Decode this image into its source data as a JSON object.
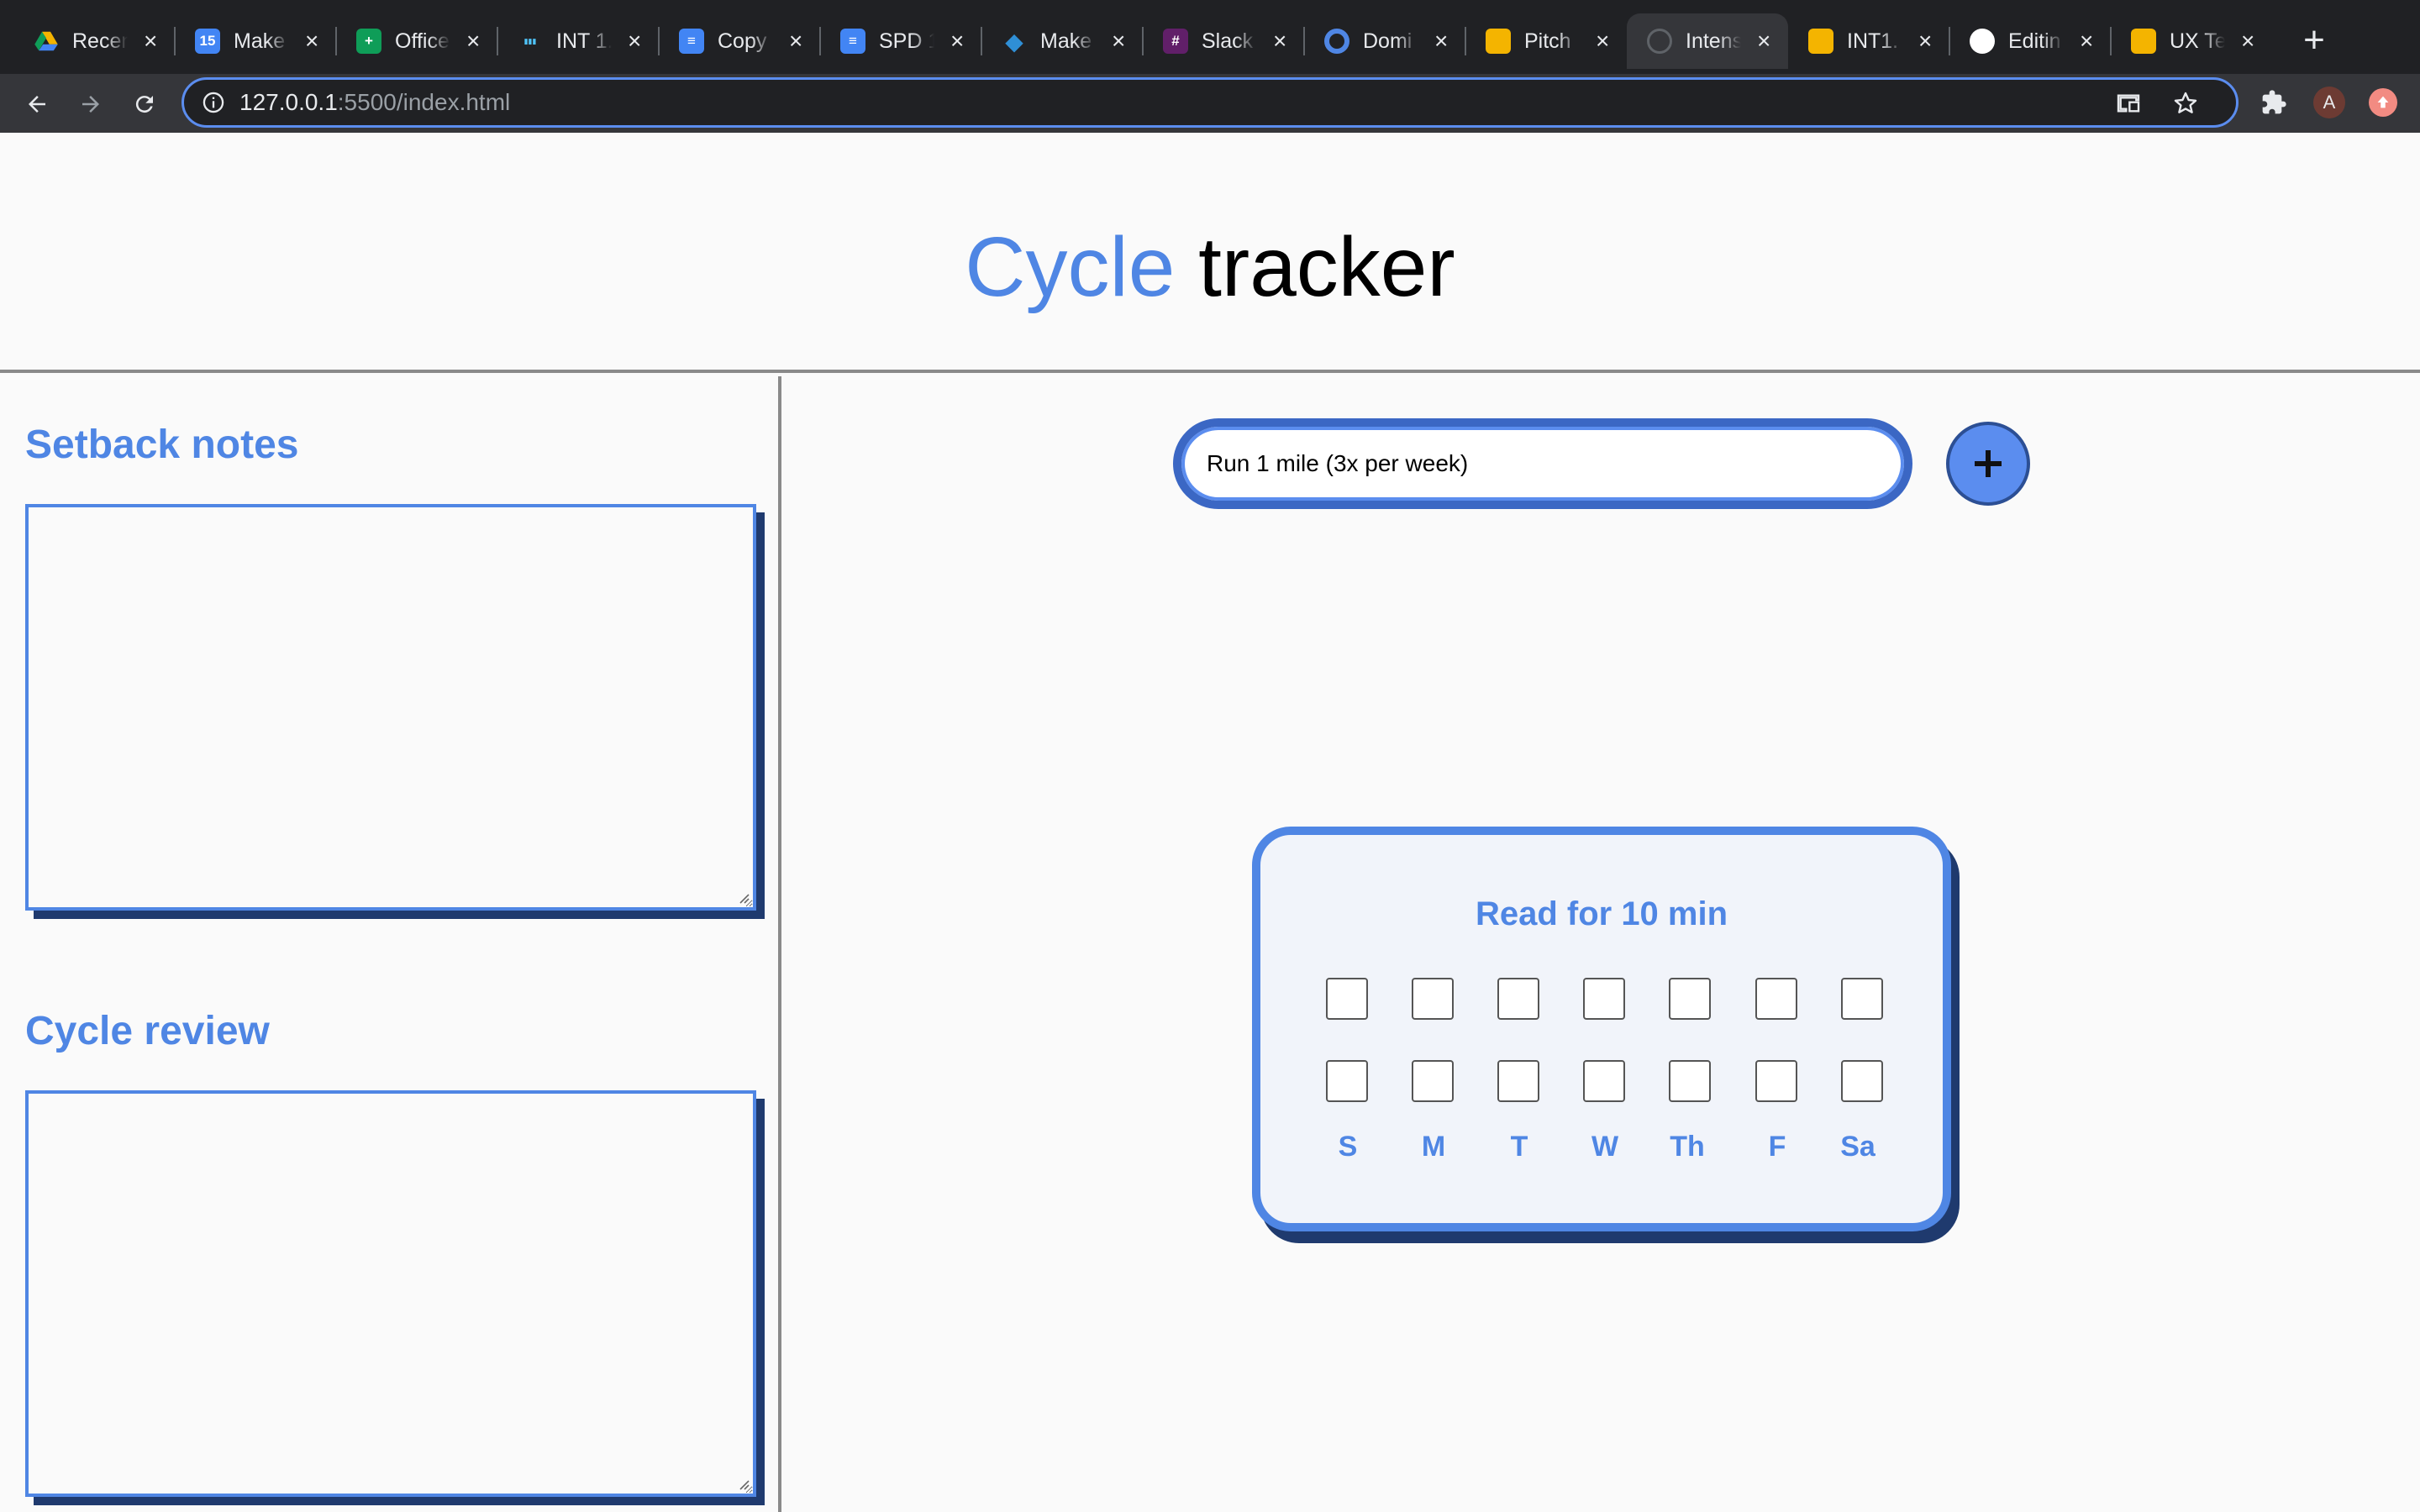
{
  "browser": {
    "tabs": [
      {
        "title": "Recent",
        "icon": "google-drive-icon",
        "color": "#f4b400"
      },
      {
        "title": "Make",
        "icon": "google-calendar-icon",
        "color": "#4285f4",
        "glyph": "15"
      },
      {
        "title": "Office",
        "icon": "google-sheets-icon",
        "color": "#0f9d58",
        "glyph": "+"
      },
      {
        "title": "INT 1.",
        "icon": "bar-chart-icon",
        "color": "#4fc3f7"
      },
      {
        "title": "Copy",
        "icon": "google-docs-icon",
        "color": "#4285f4",
        "glyph": "≡"
      },
      {
        "title": "SPD 1",
        "icon": "google-docs-icon",
        "color": "#4285f4",
        "glyph": "≡"
      },
      {
        "title": "Make",
        "icon": "diamond-icon",
        "color": "#2f8fd6",
        "glyph": "◆"
      },
      {
        "title": "Slack",
        "icon": "slack-icon",
        "color": "#611f69",
        "glyph": "#"
      },
      {
        "title": "Domi",
        "icon": "circle-logo-icon",
        "color": "#4f86e4",
        "glyph": "○"
      },
      {
        "title": "Pitch",
        "icon": "google-slides-icon",
        "color": "#f4b400"
      },
      {
        "title": "Intens",
        "icon": "globe-icon",
        "color": "#5f6368",
        "active": true
      },
      {
        "title": "INT1.",
        "icon": "google-slides-icon",
        "color": "#f4b400"
      },
      {
        "title": "Editin",
        "icon": "github-icon",
        "color": "#ffffff",
        "glyph": "●"
      },
      {
        "title": "UX Te",
        "icon": "google-slides-icon",
        "color": "#f4b400"
      }
    ],
    "url_host": "127.0.0.1",
    "url_rest": ":5500/index.html",
    "avatar_letter": "A"
  },
  "page": {
    "title_accent": "Cycle",
    "title_rest": " tracker",
    "setback_heading": "Setback notes",
    "review_heading": "Cycle review",
    "habit_input_value": "Run 1 mile (3x per week)",
    "add_button": "+",
    "card": {
      "title": "Read for 10 min",
      "days": [
        "S",
        "M",
        "T",
        "W",
        "Th",
        "F",
        "Sa"
      ],
      "rows": 2
    }
  },
  "colors": {
    "accent": "#4f86e4",
    "accent_dark": "#1f3a6e"
  }
}
